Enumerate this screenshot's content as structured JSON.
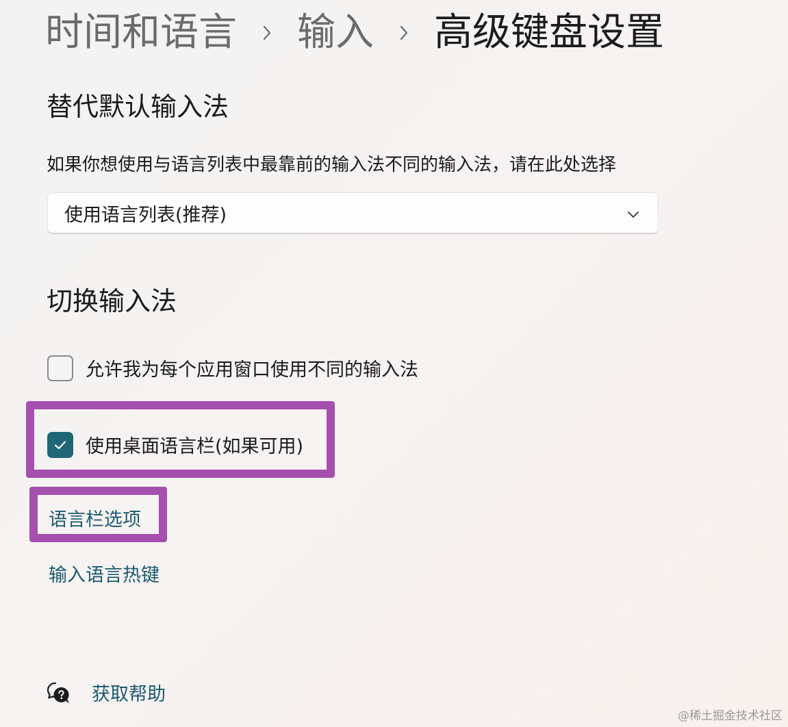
{
  "breadcrumb": {
    "items": [
      "时间和语言",
      "输入"
    ],
    "current": "高级键盘设置",
    "separator_icon": "chevron-right-icon"
  },
  "override_section": {
    "title": "替代默认输入法",
    "description": "如果你想使用与语言列表中最靠前的输入法不同的输入法，请在此处选择",
    "dropdown": {
      "value": "使用语言列表(推荐)",
      "icon": "chevron-down-icon"
    }
  },
  "switch_section": {
    "title": "切换输入法",
    "options": [
      {
        "label": "允许我为每个应用窗口使用不同的输入法",
        "checked": false
      },
      {
        "label": "使用桌面语言栏(如果可用)",
        "checked": true
      }
    ],
    "links": [
      "语言栏选项",
      "输入语言热键"
    ]
  },
  "help": {
    "label": "获取帮助",
    "icon": "help-chat-icon"
  },
  "watermark": "@稀土掘金技术社区",
  "colors": {
    "accent": "#1f6777",
    "link": "#1b5a6e",
    "highlight": "#a54fae",
    "text": "#1b1b1b",
    "muted": "#6b6b6b"
  }
}
